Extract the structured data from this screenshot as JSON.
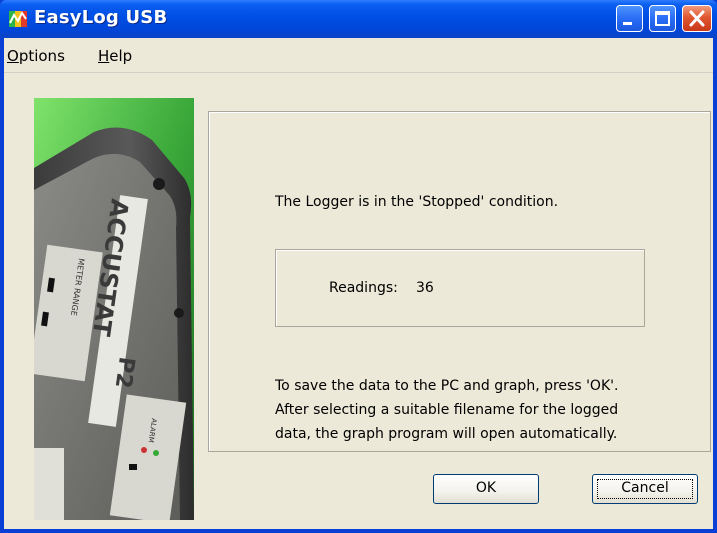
{
  "window": {
    "title": "EasyLog USB",
    "icon": "easylog-app-icon",
    "controls": [
      "minimize-icon",
      "maximize-icon",
      "close-icon"
    ]
  },
  "menu": {
    "options": {
      "accel": "O",
      "rest": "ptions"
    },
    "help": {
      "accel": "H",
      "rest": "elp"
    }
  },
  "photo": {
    "brand_text": "ACCUSTAT",
    "model_text": "P2",
    "panel_label_1": "METER RANGE",
    "panel_label_2": "ALARM"
  },
  "panel": {
    "status": "The Logger is in the 'Stopped' condition.",
    "readings_label": "Readings:",
    "readings_value": "36",
    "instructions": [
      "To save the data to the PC and graph, press 'OK'.",
      "After selecting a suitable filename for the logged",
      "data, the graph program will open automatically."
    ]
  },
  "buttons": {
    "ok": "OK",
    "cancel": "Cancel"
  },
  "colors": {
    "titlebar": "#0050e6",
    "dialog_bg": "#ece9d8",
    "close_button": "#e0572f",
    "frame": "#0a3fd6"
  }
}
